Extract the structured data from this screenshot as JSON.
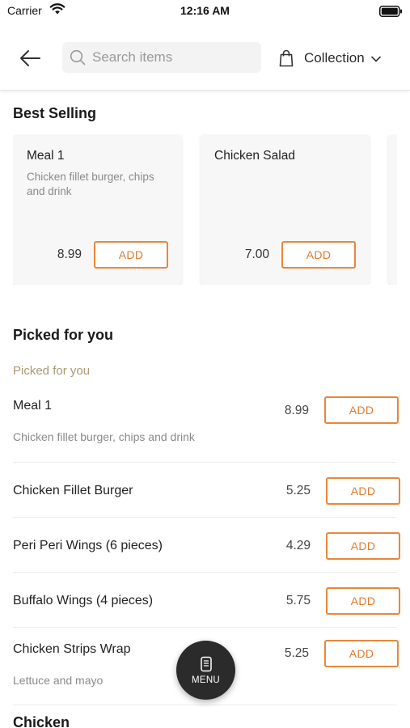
{
  "status_bar": {
    "carrier": "Carrier",
    "time": "12:16 AM"
  },
  "header": {
    "search_placeholder": "Search items",
    "collection_label": "Collection"
  },
  "best_selling": {
    "title": "Best Selling",
    "items": [
      {
        "name": "Meal 1",
        "description": "Chicken fillet burger, chips and drink",
        "price": "8.99",
        "add_label": "ADD"
      },
      {
        "name": "Chicken Salad",
        "description": "",
        "price": "7.00",
        "add_label": "ADD"
      }
    ]
  },
  "picked": {
    "title": "Picked for you",
    "subheading": "Picked for you",
    "items": [
      {
        "name": "Meal 1",
        "description": "Chicken fillet burger, chips and drink",
        "price": "8.99",
        "add_label": "ADD"
      },
      {
        "name": "Chicken Fillet Burger",
        "description": "",
        "price": "5.25",
        "add_label": "ADD"
      },
      {
        "name": "Peri Peri Wings (6 pieces)",
        "description": "",
        "price": "4.29",
        "add_label": "ADD"
      },
      {
        "name": "Buffalo Wings (4 pieces)",
        "description": "",
        "price": "5.75",
        "add_label": "ADD"
      },
      {
        "name": "Chicken Strips Wrap",
        "description": "Lettuce and mayo",
        "price": "5.25",
        "add_label": "ADD"
      }
    ]
  },
  "next_section": {
    "title": "Chicken"
  },
  "menu_button": {
    "label": "MENU"
  },
  "colors": {
    "accent": "#e8873a",
    "subheading": "#a89a72",
    "fab": "#2b2b2b"
  }
}
